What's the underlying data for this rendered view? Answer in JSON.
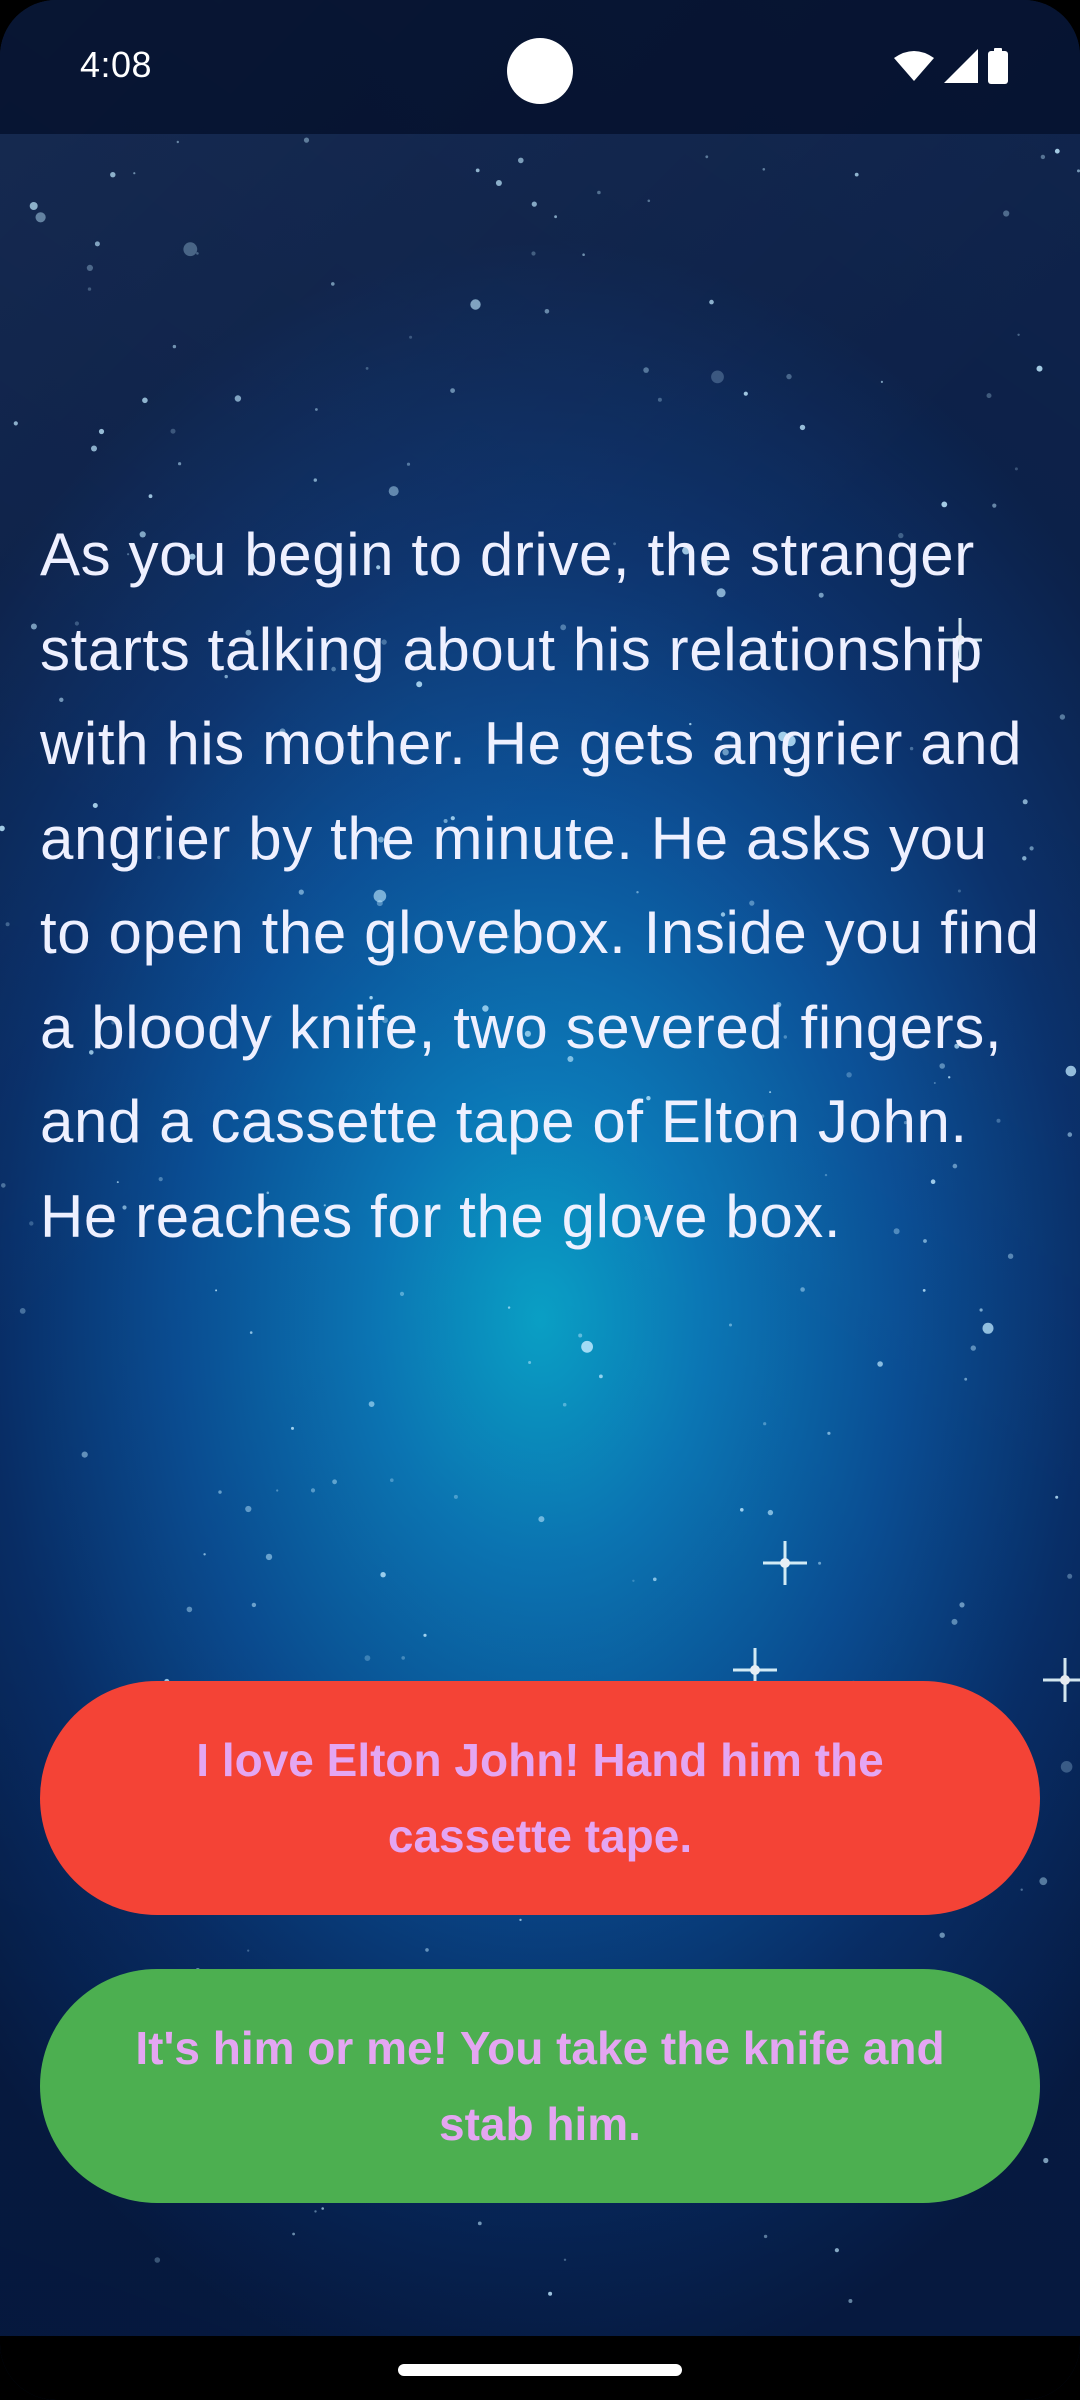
{
  "status_bar": {
    "time": "4:08",
    "icons": [
      "wifi-icon",
      "cellular-signal-icon",
      "battery-icon"
    ]
  },
  "story": {
    "text": "As you begin to drive, the stranger starts talking about his relationship with his mother. He gets angrier and angrier by the minute. He asks you to open the glovebox. Inside you find a bloody knife, two severed fingers, and a cassette tape of Elton John. He reaches for the glove box."
  },
  "choices": [
    {
      "label": "I love Elton John! Hand him the cassette tape.",
      "color": "#f44336"
    },
    {
      "label": "It's him or me! You take the knife and stab him.",
      "color": "#4caf50"
    }
  ],
  "colors": {
    "background_center": "#0aa3c9",
    "background_edge": "#061b44",
    "text": "#eef0ff",
    "button_text": "#e4a6f2"
  }
}
